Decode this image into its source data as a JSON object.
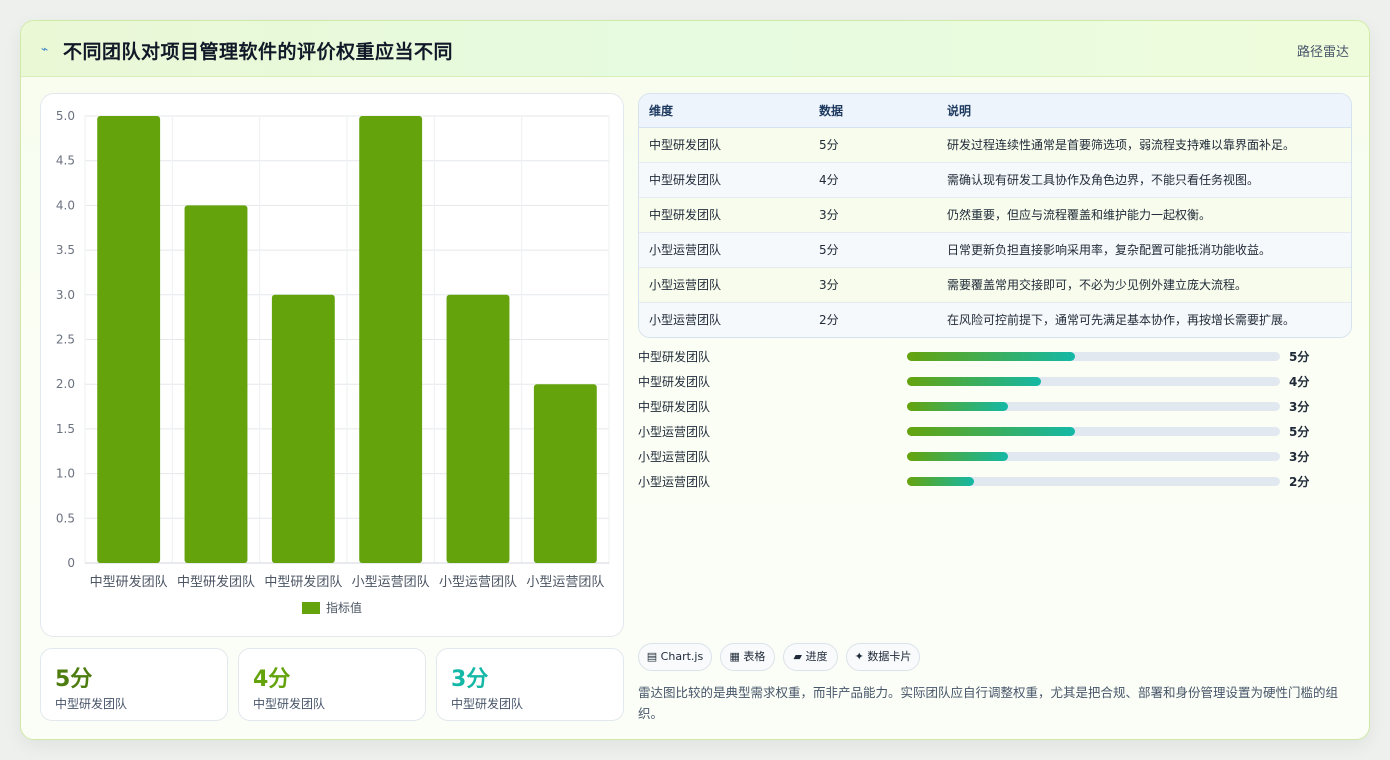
{
  "header": {
    "title": "不同团队对项目管理软件的评价权重应当不同",
    "tag": "路径雷达"
  },
  "chart_data": {
    "type": "bar",
    "categories": [
      "中型研发团队",
      "中型研发团队",
      "中型研发团队",
      "小型运营团队",
      "小型运营团队",
      "小型运营团队"
    ],
    "series": [
      {
        "name": "指标值",
        "values": [
          5,
          4,
          3,
          5,
          3,
          2
        ],
        "color": "#65a30d"
      }
    ],
    "ylim": [
      0,
      5
    ],
    "yticks": [
      0,
      0.5,
      1.0,
      1.5,
      2.0,
      2.5,
      3.0,
      3.5,
      4.0,
      4.5,
      5.0
    ],
    "ytick_labels": [
      "0",
      "0.5",
      "1.0",
      "1.5",
      "2.0",
      "2.5",
      "3.0",
      "3.5",
      "4.0",
      "4.5",
      "5.0"
    ],
    "grid": true,
    "legend": "bottom"
  },
  "kpis": [
    {
      "value": "5分",
      "label": "中型研发团队",
      "color": "#4d7c0f"
    },
    {
      "value": "4分",
      "label": "中型研发团队",
      "color": "#65a30d"
    },
    {
      "value": "3分",
      "label": "中型研发团队",
      "color": "#14b8a6"
    }
  ],
  "table": {
    "headers": [
      "维度",
      "数据",
      "说明"
    ],
    "rows": [
      [
        "中型研发团队",
        "5分",
        "研发过程连续性通常是首要筛选项，弱流程支持难以靠界面补足。"
      ],
      [
        "中型研发团队",
        "4分",
        "需确认现有研发工具协作及角色边界，不能只看任务视图。"
      ],
      [
        "中型研发团队",
        "3分",
        "仍然重要，但应与流程覆盖和维护能力一起权衡。"
      ],
      [
        "小型运营团队",
        "5分",
        "日常更新负担直接影响采用率，复杂配置可能抵消功能收益。"
      ],
      [
        "小型运营团队",
        "3分",
        "需要覆盖常用交接即可，不必为少见例外建立庞大流程。"
      ],
      [
        "小型运营团队",
        "2分",
        "在风险可控前提下，通常可先满足基本协作，再按增长需要扩展。"
      ]
    ]
  },
  "progress": [
    {
      "label": "中型研发团队",
      "value_text": "5分",
      "fraction": 0.45
    },
    {
      "label": "中型研发团队",
      "value_text": "4分",
      "fraction": 0.36
    },
    {
      "label": "中型研发团队",
      "value_text": "3分",
      "fraction": 0.27
    },
    {
      "label": "小型运营团队",
      "value_text": "5分",
      "fraction": 0.45
    },
    {
      "label": "小型运营团队",
      "value_text": "3分",
      "fraction": 0.27
    },
    {
      "label": "小型运营团队",
      "value_text": "2分",
      "fraction": 0.18
    }
  ],
  "chips": [
    "▤ Chart.js",
    "▦ 表格",
    "▰ 进度",
    "✦ 数据卡片"
  ],
  "note": "雷达图比较的是典型需求权重，而非产品能力。实际团队应自行调整权重，尤其是把合规、部署和身份管理设置为硬性门槛的组织。"
}
